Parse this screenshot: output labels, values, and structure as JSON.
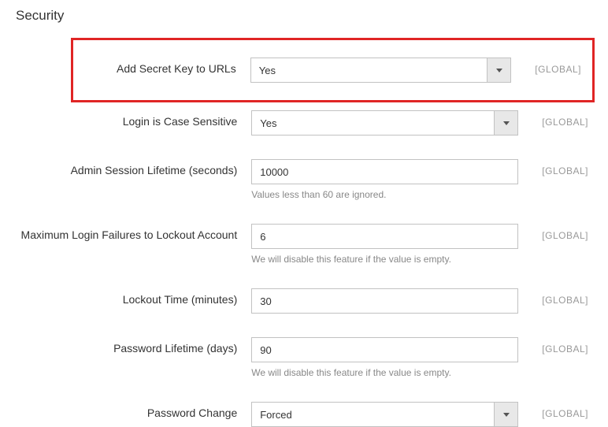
{
  "section": {
    "title": "Security"
  },
  "scope_label": "[GLOBAL]",
  "fields": {
    "secret_key": {
      "label": "Add Secret Key to URLs",
      "value": "Yes"
    },
    "case_sensitive": {
      "label": "Login is Case Sensitive",
      "value": "Yes"
    },
    "session_lifetime": {
      "label": "Admin Session Lifetime (seconds)",
      "value": "10000",
      "hint": "Values less than 60 are ignored."
    },
    "max_failures": {
      "label": "Maximum Login Failures to Lockout Account",
      "value": "6",
      "hint": "We will disable this feature if the value is empty."
    },
    "lockout_time": {
      "label": "Lockout Time (minutes)",
      "value": "30"
    },
    "password_lifetime": {
      "label": "Password Lifetime (days)",
      "value": "90",
      "hint": "We will disable this feature if the value is empty."
    },
    "password_change": {
      "label": "Password Change",
      "value": "Forced"
    }
  }
}
